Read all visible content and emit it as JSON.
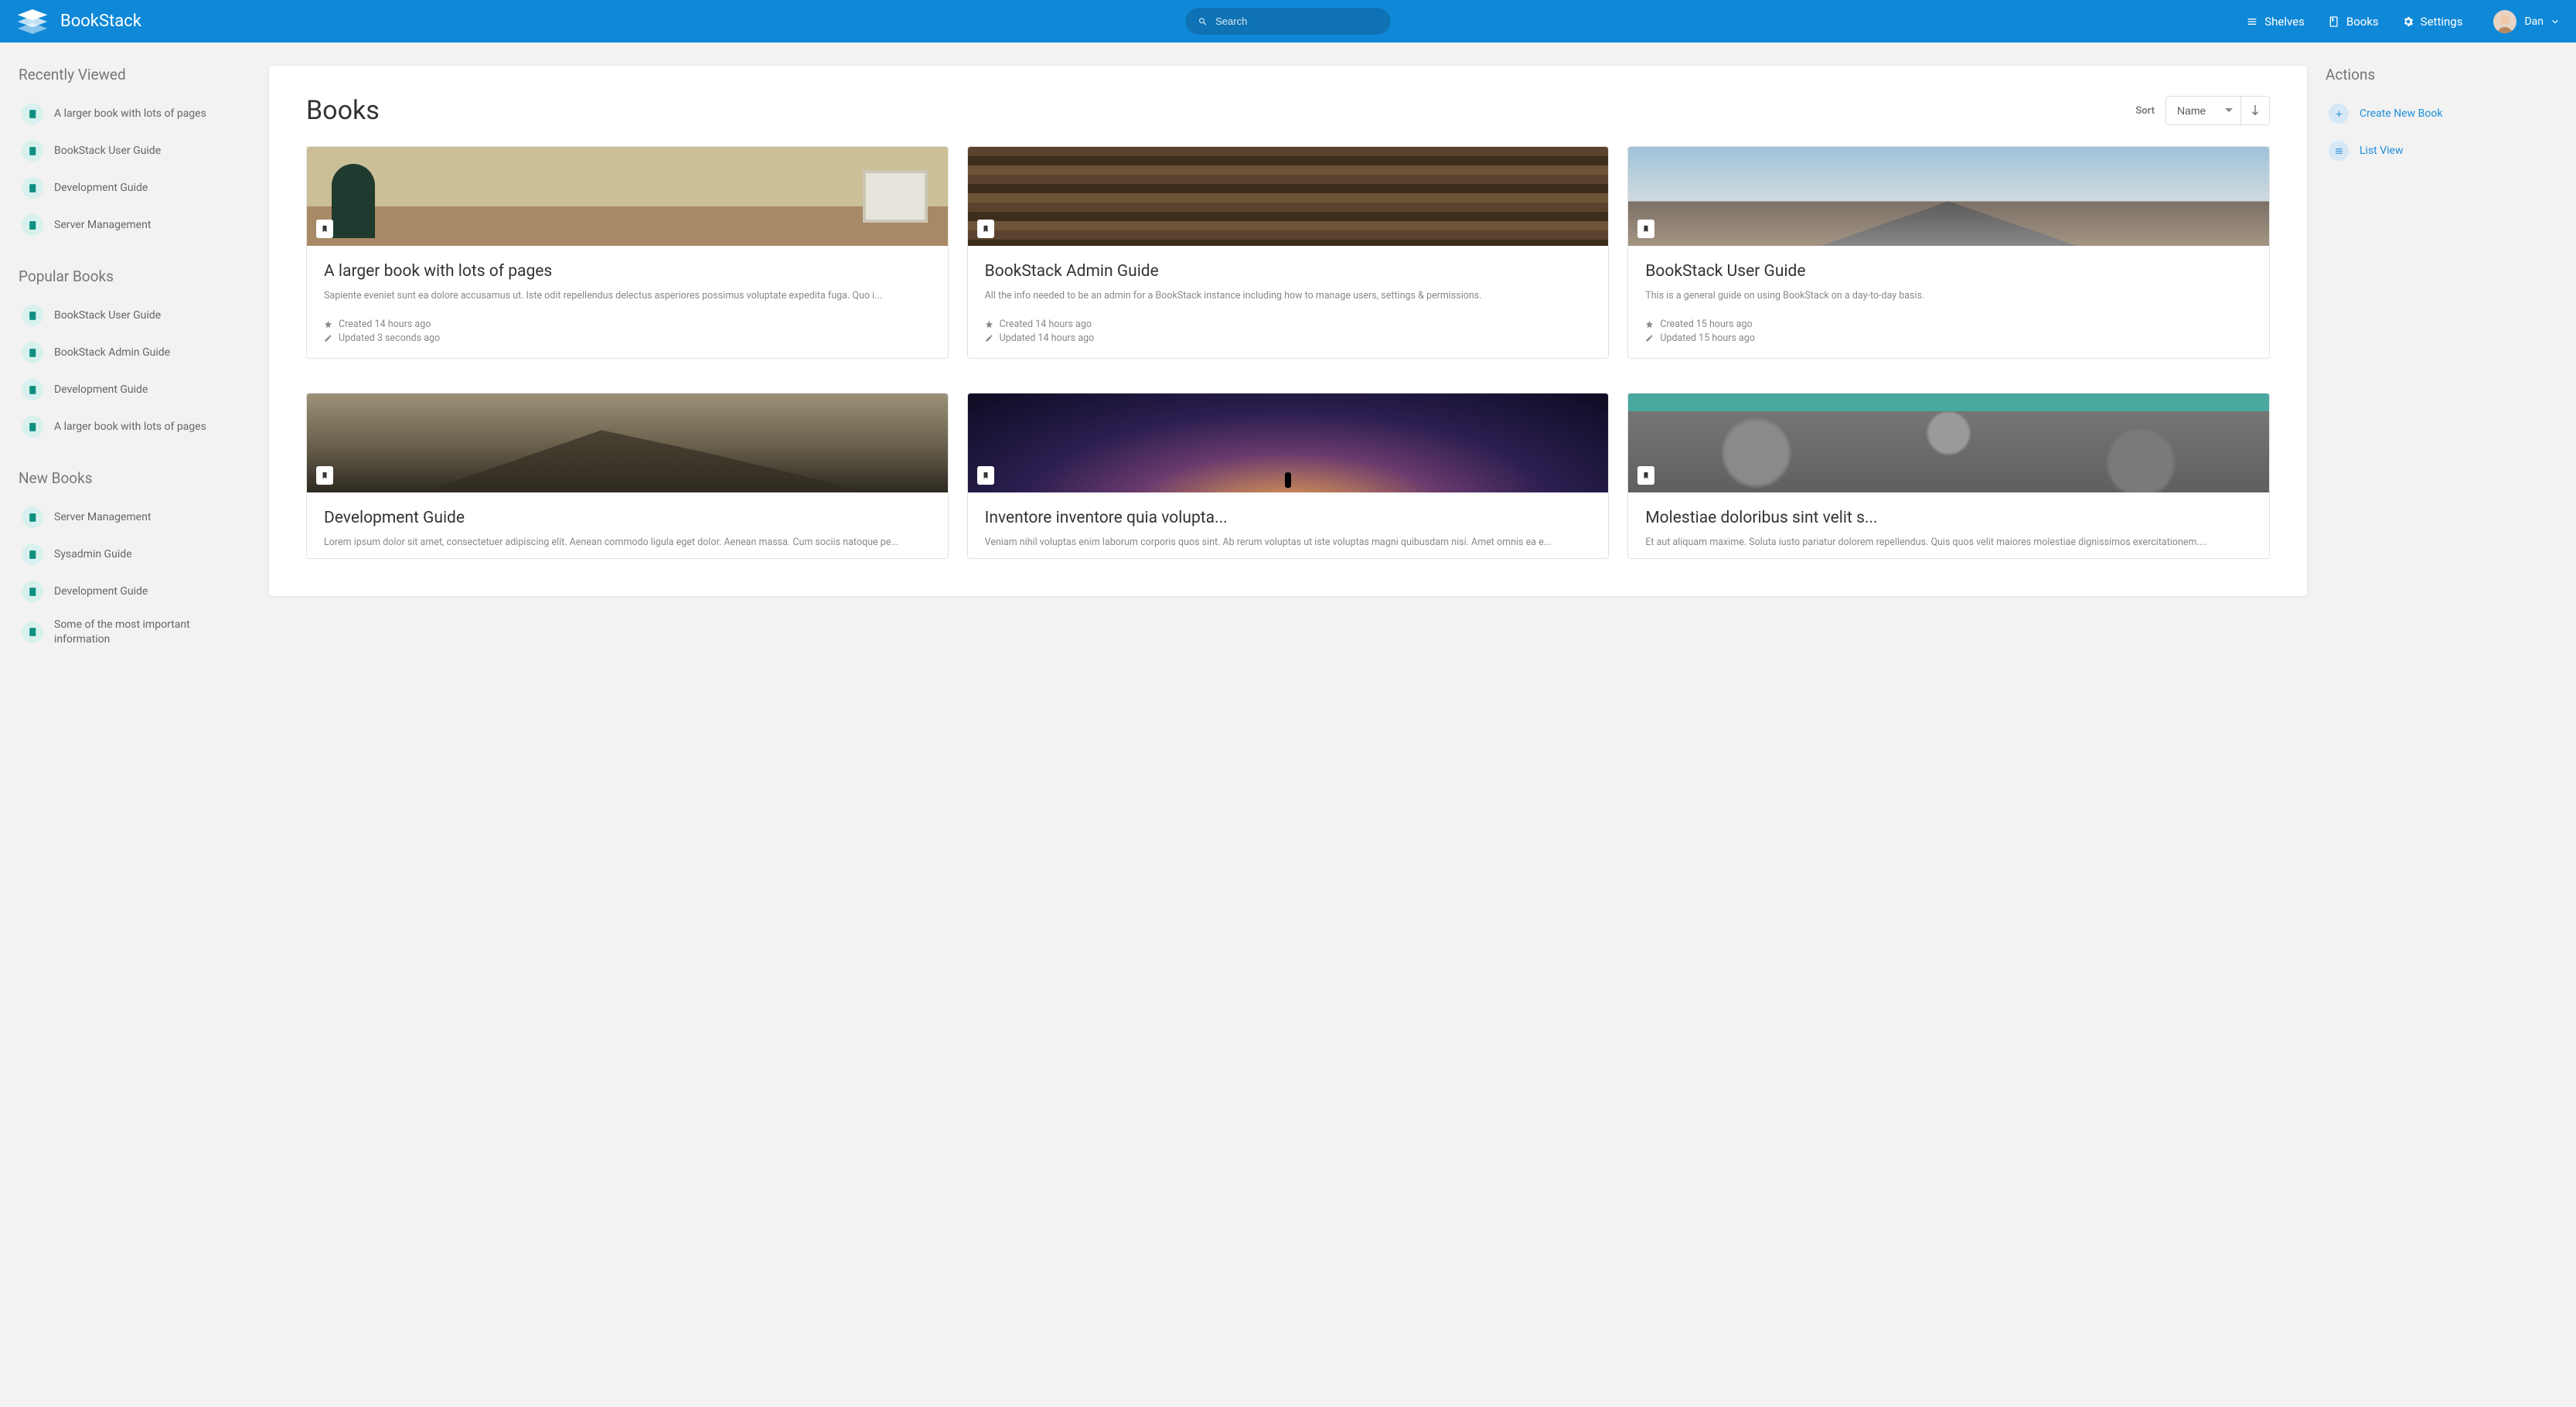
{
  "brand": "BookStack",
  "search": {
    "placeholder": "Search"
  },
  "nav": {
    "shelves": "Shelves",
    "books": "Books",
    "settings": "Settings",
    "user": "Dan"
  },
  "left": {
    "recent_heading": "Recently Viewed",
    "recent": [
      "A larger book with lots of pages",
      "BookStack User Guide",
      "Development Guide",
      "Server Management"
    ],
    "popular_heading": "Popular Books",
    "popular": [
      "BookStack User Guide",
      "BookStack Admin Guide",
      "Development Guide",
      "A larger book with lots of pages"
    ],
    "new_heading": "New Books",
    "new": [
      "Server Management",
      "Sysadmin Guide",
      "Development Guide",
      "Some of the most important information"
    ]
  },
  "right": {
    "actions_heading": "Actions",
    "create": "Create New Book",
    "list_view": "List View"
  },
  "main": {
    "title": "Books",
    "sort_label": "Sort",
    "sort_value": "Name"
  },
  "cards": [
    {
      "title": "A larger book with lots of pages",
      "desc": "Sapiente eveniet sunt ea dolore accusamus ut. Iste odit repellendus delectus asperiores possimus voluptate expedita fuga. Quo i...",
      "created": "Created 14 hours ago",
      "updated": "Updated 3 seconds ago",
      "cov": "cov0"
    },
    {
      "title": "BookStack Admin Guide",
      "desc": "All the info needed to be an admin for a BookStack instance including how to manage users, settings & permissions.",
      "created": "Created 14 hours ago",
      "updated": "Updated 14 hours ago",
      "cov": "cov1"
    },
    {
      "title": "BookStack User Guide",
      "desc": "This is a general guide on using BookStack on a day-to-day basis.",
      "created": "Created 15 hours ago",
      "updated": "Updated 15 hours ago",
      "cov": "cov2"
    },
    {
      "title": "Development Guide",
      "desc": "Lorem ipsum dolor sit amet, consectetuer adipiscing elit. Aenean commodo ligula eget dolor. Aenean massa. Cum sociis natoque pe...",
      "created": "",
      "updated": "",
      "cov": "cov3"
    },
    {
      "title": "Inventore inventore quia volupta...",
      "desc": "Veniam nihil voluptas enim laborum corporis quos sint. Ab rerum voluptas ut iste voluptas magni quibusdam nisi. Amet omnis ea e...",
      "created": "",
      "updated": "",
      "cov": "cov4"
    },
    {
      "title": "Molestiae doloribus sint velit s...",
      "desc": "Et aut aliquam maxime. Soluta iusto pariatur dolorem repellendus. Quis quos velit maiores molestiae dignissimos exercitationem....",
      "created": "",
      "updated": "",
      "cov": "cov5"
    }
  ]
}
